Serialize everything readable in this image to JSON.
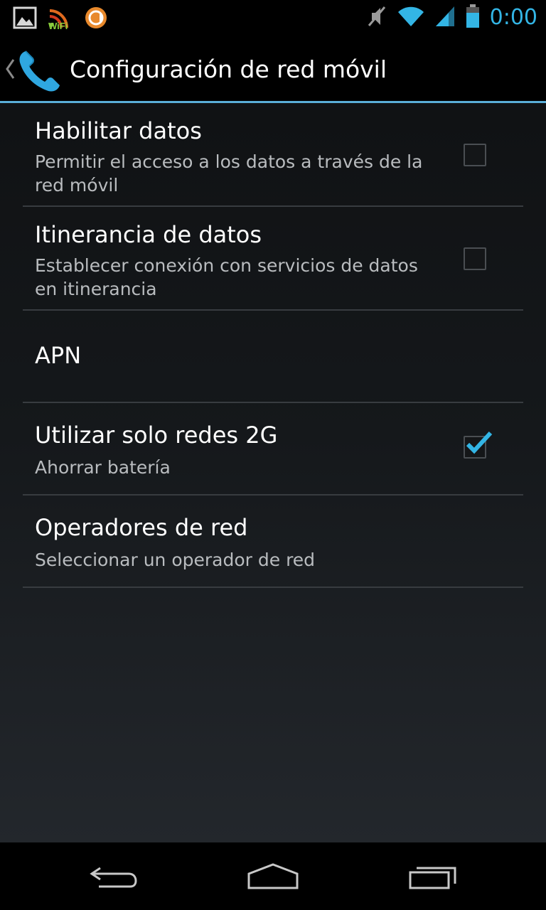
{
  "status_bar": {
    "time": "0:00",
    "left_icons": [
      "picture-icon",
      "wifi-app-icon",
      "orange-app-icon"
    ],
    "right_icons": [
      "mute-icon",
      "wifi-signal-icon",
      "cell-signal-icon",
      "battery-icon"
    ],
    "wifi_app_label": "WiFi",
    "accent_color": "#33b5e5"
  },
  "action_bar": {
    "title": "Configuración de red móvil",
    "icon": "phone-icon"
  },
  "preferences": [
    {
      "title": "Habilitar datos",
      "summary": "Permitir el acceso a los datos a través de la red móvil",
      "checkbox": true,
      "checked": false
    },
    {
      "title": "Itinerancia de datos",
      "summary": "Establecer conexión con servicios de datos en itinerancia",
      "checkbox": true,
      "checked": false
    },
    {
      "title": "APN",
      "summary": "",
      "checkbox": false
    },
    {
      "title": "Utilizar solo redes 2G",
      "summary": "Ahorrar batería",
      "checkbox": true,
      "checked": true
    },
    {
      "title": "Operadores de red",
      "summary": "Seleccionar un operador de red",
      "checkbox": false
    }
  ],
  "nav_bar": {
    "buttons": [
      "back-icon",
      "home-icon",
      "recent-apps-icon"
    ]
  }
}
